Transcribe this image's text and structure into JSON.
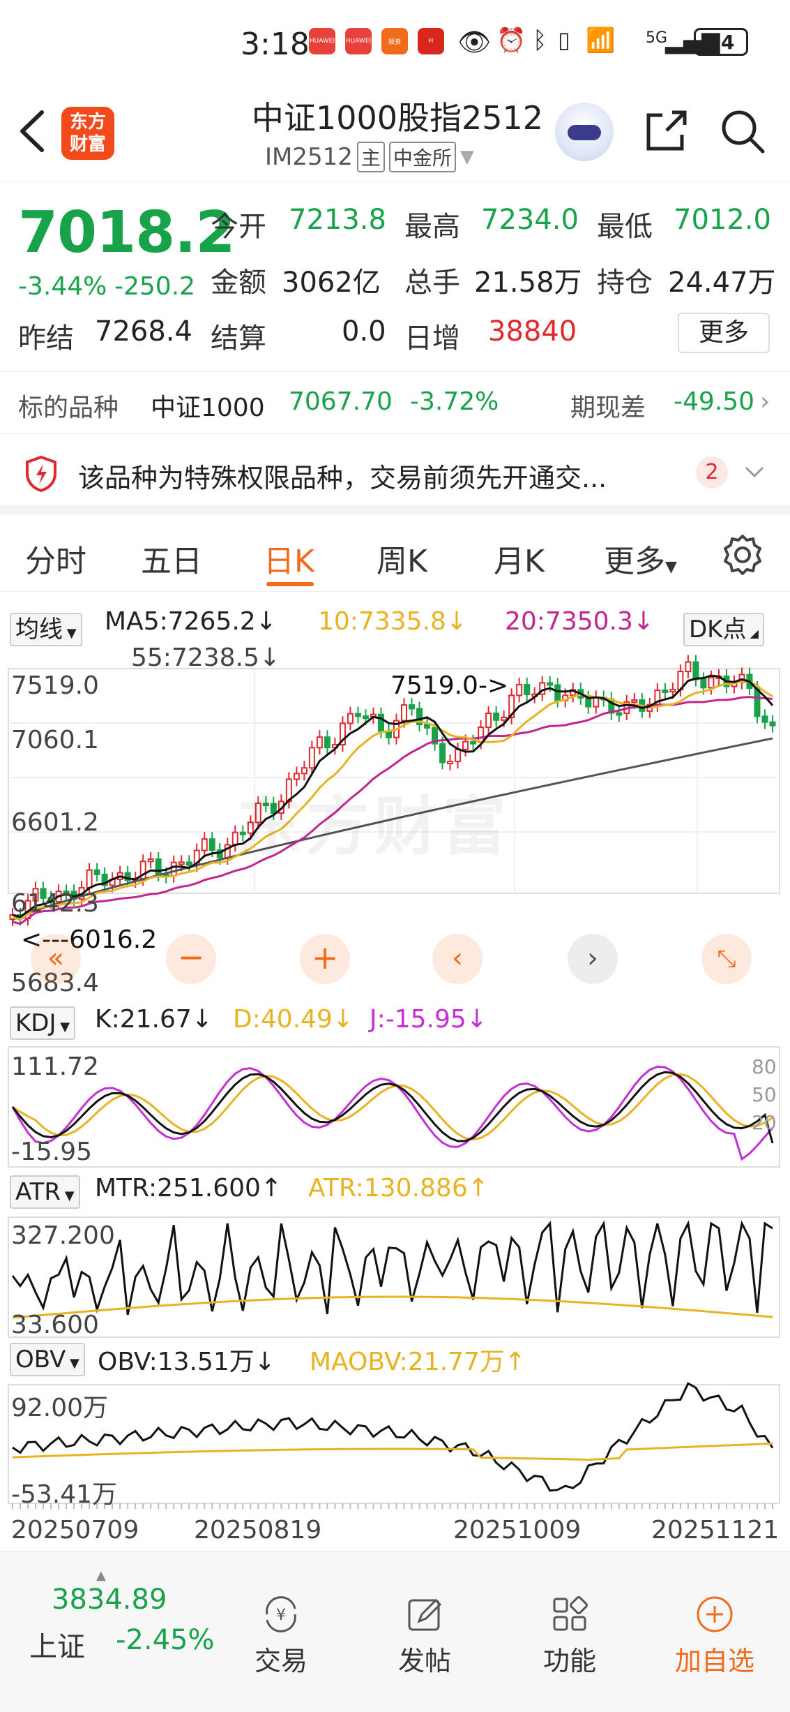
{
  "status_bar": {
    "time": "3:18",
    "apps": [
      "HUAWEI",
      "HUAWEI",
      "顺货",
      "H"
    ],
    "network": "5G",
    "battery": "94"
  },
  "header": {
    "title": "中证1000股指2512",
    "code": "IM2512",
    "tag_main": "主",
    "exchange": "中金所",
    "logo_line1": "东方",
    "logo_line2": "财富"
  },
  "quote": {
    "price": "7018.2",
    "change_pct": "-3.44%",
    "change": "-250.2",
    "fields": [
      {
        "label": "今开",
        "value": "7213.8",
        "color": "green"
      },
      {
        "label": "最高",
        "value": "7234.0",
        "color": "green"
      },
      {
        "label": "最低",
        "value": "7012.0",
        "color": "green"
      },
      {
        "label": "金额",
        "value": "3062亿",
        "color": "black"
      },
      {
        "label": "总手",
        "value": "21.58万",
        "color": "black"
      },
      {
        "label": "持仓",
        "value": "24.47万",
        "color": "black"
      },
      {
        "label": "昨结",
        "value": "7268.4",
        "color": "black"
      },
      {
        "label": "结算",
        "value": "0.0",
        "color": "black"
      },
      {
        "label": "日增",
        "value": "38840",
        "color": "red"
      }
    ],
    "more_label": "更多"
  },
  "underlying": {
    "label": "标的品种",
    "name": "中证1000",
    "price": "7067.70",
    "pct": "-3.72%",
    "basis_label": "期现差",
    "basis": "-49.50"
  },
  "notice": {
    "text": "该品种为特殊权限品种，交易前须先开通交...",
    "count": "2"
  },
  "tabs": [
    "分时",
    "五日",
    "日K",
    "周K",
    "月K",
    "更多"
  ],
  "active_tab": "日K",
  "ma_panel": {
    "selector": "均线",
    "ma5": "MA5:7265.2↓",
    "ma10": "10:7335.8↓",
    "ma20": "20:7350.3↓",
    "ma55": "55:7238.5↓",
    "dk_button": "DK点",
    "y_labels": [
      "7519.0",
      "7060.1",
      "6601.2",
      "6142.3",
      "5683.4"
    ],
    "high_mark": "7519.0->",
    "low_mark": "<---6016.2"
  },
  "kdj_panel": {
    "selector": "KDJ",
    "k": "K:21.67↓",
    "d": "D:40.49↓",
    "j": "J:-15.95↓",
    "y_top": "111.72",
    "y_bottom": "-15.95",
    "levels": [
      "80",
      "50",
      "20"
    ]
  },
  "atr_panel": {
    "selector": "ATR",
    "mtr": "MTR:251.600↑",
    "atr": "ATR:130.886↑",
    "y_top": "327.200",
    "y_bottom": "33.600"
  },
  "obv_panel": {
    "selector": "OBV",
    "obv": "OBV:13.51万↓",
    "maobv": "MAOBV:21.77万↑",
    "y_top": "92.00万",
    "y_bottom": "-53.41万"
  },
  "x_dates": [
    "20250709",
    "20250819",
    "20251009",
    "20251121"
  ],
  "watermark": "东方财富",
  "bottom_nav": {
    "index_value": "3834.89",
    "index_name": "上证",
    "index_pct": "-2.45%",
    "items": [
      "交易",
      "发帖",
      "功能",
      "加自选"
    ]
  },
  "colors": {
    "up": "#e0282e",
    "down": "#18a34a",
    "accent": "#f26a1b",
    "ma10": "#e8b323",
    "ma20": "#c4248f"
  }
}
